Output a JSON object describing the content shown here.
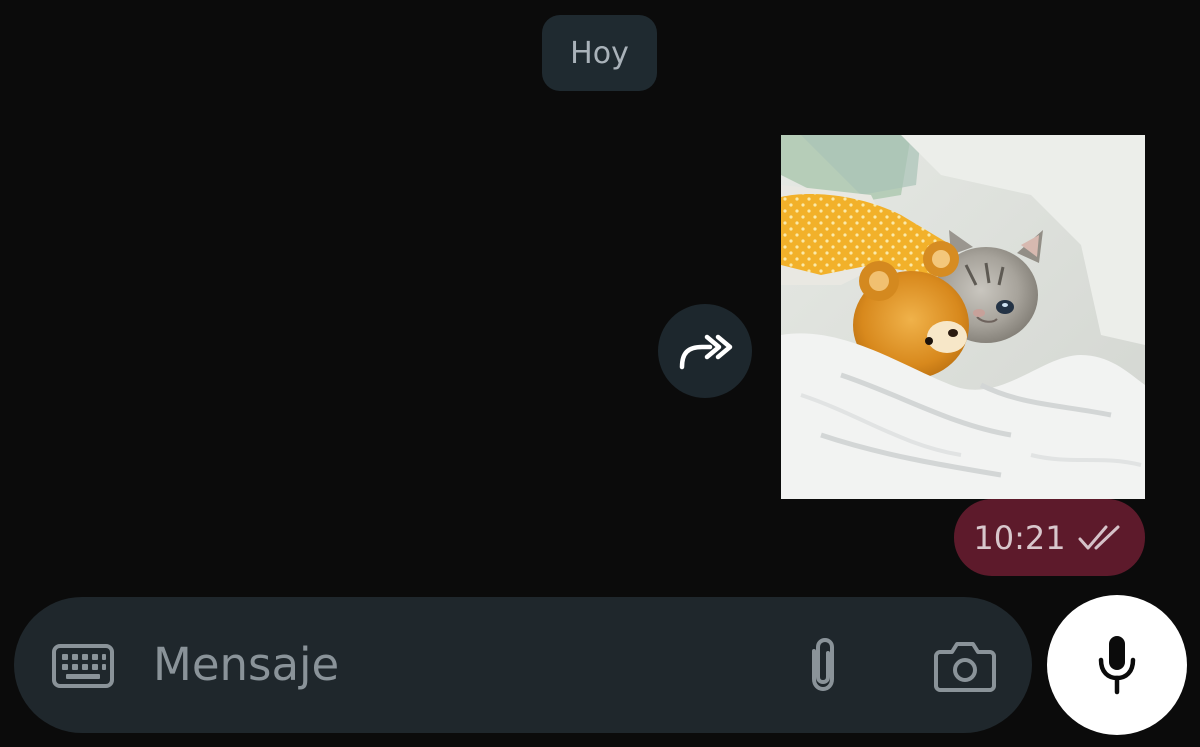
{
  "chat": {
    "date_divider": "Hoy",
    "message": {
      "time": "10:21",
      "status_icon": "double-check-icon",
      "bubble_color": "#5d1a2b"
    },
    "forward_icon": "forward-icon"
  },
  "composer": {
    "placeholder": "Mensaje",
    "icons": {
      "keyboard": "keyboard-icon",
      "attach": "paperclip-icon",
      "camera": "camera-icon",
      "mic": "microphone-icon"
    }
  }
}
